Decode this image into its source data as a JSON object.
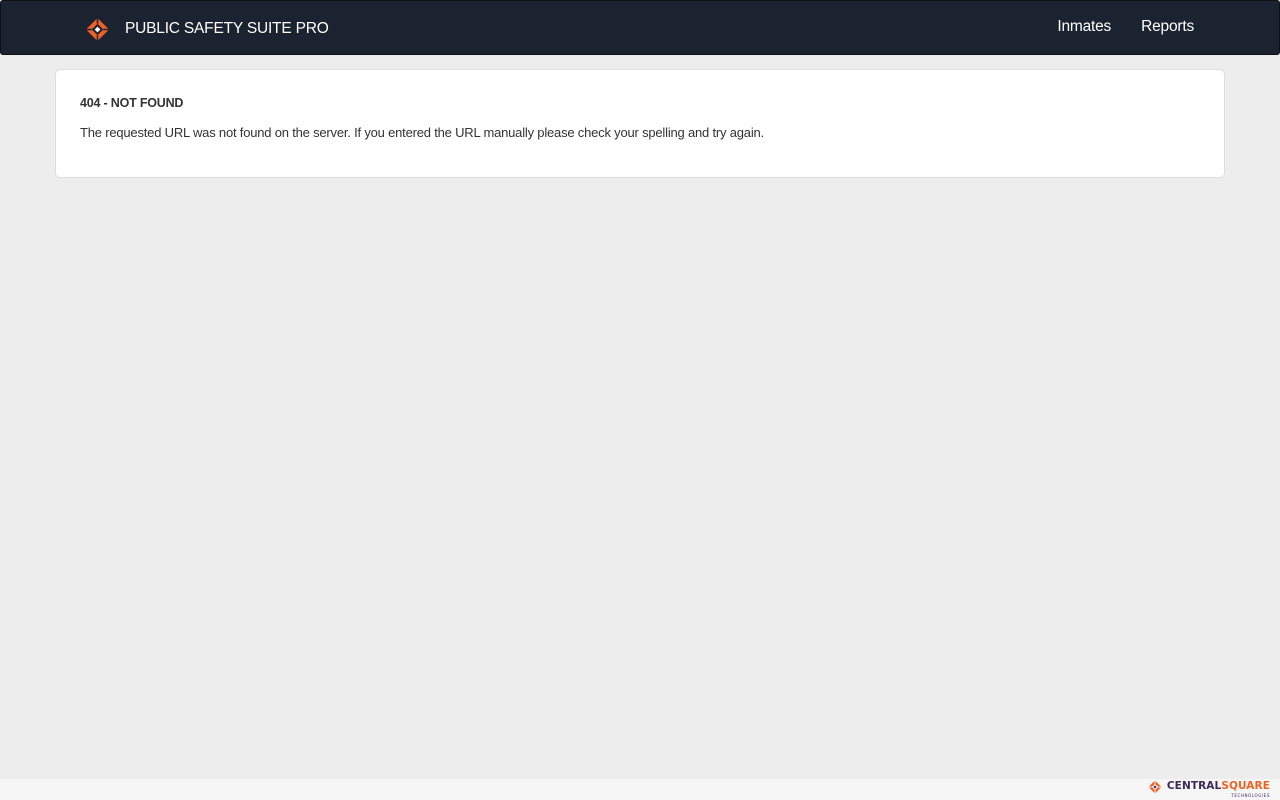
{
  "header": {
    "brand_name": "PUBLIC SAFETY SUITE PRO",
    "logo_icon": "centralsquare-diamond-icon",
    "nav": [
      {
        "label": "Inmates"
      },
      {
        "label": "Reports"
      }
    ]
  },
  "error": {
    "title": "404 - NOT FOUND",
    "message": "The requested URL was not found on the server. If you entered the URL manually please check your spelling and try again."
  },
  "footer": {
    "logo_part1": "CENTRAL",
    "logo_part2": "SQUARE",
    "logo_subtext": "TECHNOLOGIES"
  },
  "colors": {
    "navbar_bg": "#1b2331",
    "accent_orange": "#ef6223",
    "page_bg": "#ededed",
    "card_bg": "#ffffff",
    "brand_purple": "#3a2a5a"
  }
}
